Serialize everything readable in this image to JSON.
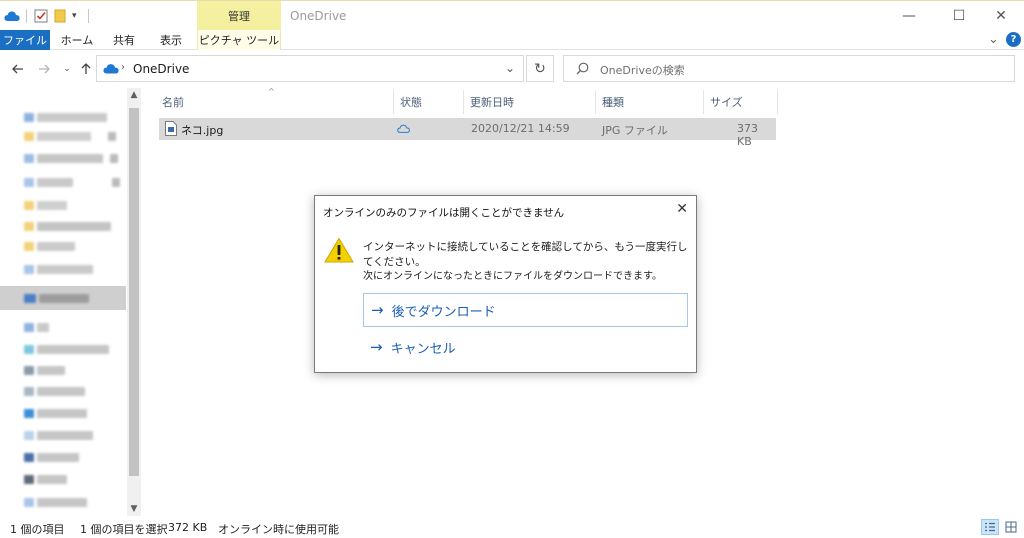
{
  "window": {
    "title": "OneDrive",
    "manage_tab": "管理",
    "minimize": "—",
    "maximize": "☐",
    "close": "✕"
  },
  "ribbon": {
    "tabs": [
      "ファイル",
      "ホーム",
      "共有",
      "表示",
      "ピクチャ ツール"
    ],
    "expand": "⌄",
    "help": "?"
  },
  "address": {
    "path": "OneDrive",
    "dropdown": "⌄",
    "refresh": "↻"
  },
  "search": {
    "placeholder": "OneDriveの検索"
  },
  "columns": {
    "name": "名前",
    "status": "状態",
    "modified": "更新日時",
    "type": "種類",
    "size": "サイズ"
  },
  "files": [
    {
      "name": "ネコ.jpg",
      "modified": "2020/12/21 14:59",
      "type": "JPG ファイル",
      "size": "373 KB"
    }
  ],
  "dialog": {
    "title": "オンラインのみのファイルは開くことができません",
    "message1": "インターネットに接続していることを確認してから、もう一度実行してください。",
    "message2": "次にオンラインになったときにファイルをダウンロードできます。",
    "download_later": "後でダウンロード",
    "cancel": "キャンセル",
    "close": "✕"
  },
  "statusbar": {
    "item_count": "1 個の項目",
    "selected": "1 個の項目を選択",
    "selected_size": "372 KB",
    "availability": "オンライン時に使用可能"
  },
  "colors": {
    "accent": "#1a6fc2",
    "manage_tab": "#f5f0a0",
    "onedrive": "#1e78d4",
    "selection": "#d9d9d9",
    "link": "#1a5fb4",
    "warning": "#f5d000"
  }
}
